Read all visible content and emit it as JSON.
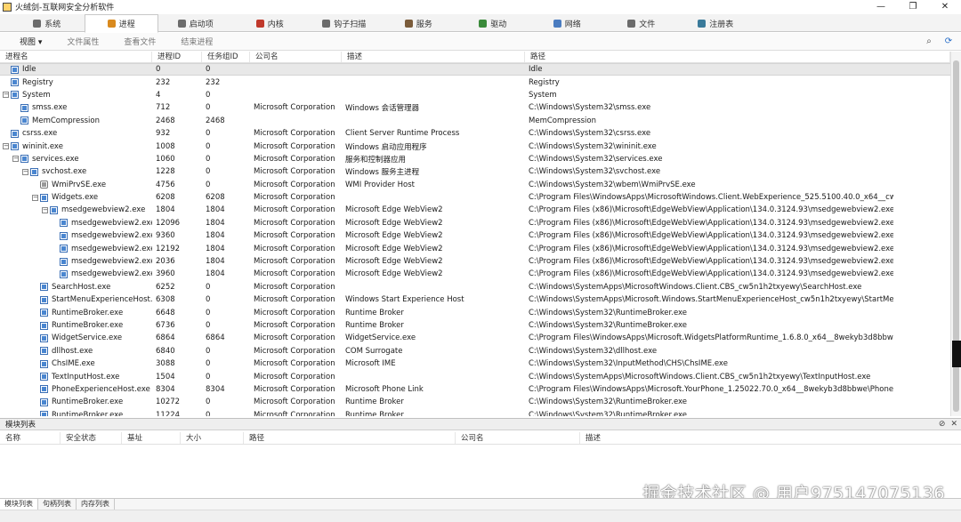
{
  "window": {
    "title": "火绒剑-互联网安全分析软件",
    "controls": [
      "—",
      "❐",
      "✕"
    ]
  },
  "tabs": [
    {
      "label": "系统",
      "icon": "system-icon",
      "color": "#6b6b6b"
    },
    {
      "label": "进程",
      "icon": "process-icon",
      "color": "#d98a1e",
      "active": true
    },
    {
      "label": "启动项",
      "icon": "startup-icon",
      "color": "#6b6b6b"
    },
    {
      "label": "内核",
      "icon": "kernel-icon",
      "color": "#c0392b"
    },
    {
      "label": "钩子扫描",
      "icon": "hook-icon",
      "color": "#6b6b6b"
    },
    {
      "label": "服务",
      "icon": "service-icon",
      "color": "#7a5b3a"
    },
    {
      "label": "驱动",
      "icon": "driver-icon",
      "color": "#3a8a3a"
    },
    {
      "label": "网络",
      "icon": "network-icon",
      "color": "#4a7cc0"
    },
    {
      "label": "文件",
      "icon": "file-icon",
      "color": "#6b6b6b"
    },
    {
      "label": "注册表",
      "icon": "registry-icon",
      "color": "#3a7a9a"
    }
  ],
  "toolbar": {
    "view": "视图 ▾",
    "file_props": "文件属性",
    "view_file": "查看文件",
    "end_process": "结束进程"
  },
  "columns": {
    "name": "进程名",
    "pid": "进程ID",
    "tgid": "任务组ID",
    "company": "公司名",
    "desc": "描述",
    "path": "路径"
  },
  "processes": [
    {
      "name": "Idle",
      "pid": "0",
      "tgid": "0",
      "company": "",
      "desc": "",
      "path": "Idle",
      "level": 0,
      "exp": "",
      "sel": true
    },
    {
      "name": "Registry",
      "pid": "232",
      "tgid": "232",
      "company": "",
      "desc": "",
      "path": "Registry",
      "level": 0,
      "exp": ""
    },
    {
      "name": "System",
      "pid": "4",
      "tgid": "0",
      "company": "",
      "desc": "",
      "path": "System",
      "level": 0,
      "exp": "−"
    },
    {
      "name": "smss.exe",
      "pid": "712",
      "tgid": "0",
      "company": "Microsoft Corporation",
      "desc": "Windows 会话管理器",
      "path": "C:\\Windows\\System32\\smss.exe",
      "level": 1,
      "exp": ""
    },
    {
      "name": "MemCompression",
      "pid": "2468",
      "tgid": "2468",
      "company": "",
      "desc": "",
      "path": "MemCompression",
      "level": 1,
      "exp": ""
    },
    {
      "name": "csrss.exe",
      "pid": "932",
      "tgid": "0",
      "company": "Microsoft Corporation",
      "desc": "Client Server Runtime Process",
      "path": "C:\\Windows\\System32\\csrss.exe",
      "level": 0,
      "exp": ""
    },
    {
      "name": "wininit.exe",
      "pid": "1008",
      "tgid": "0",
      "company": "Microsoft Corporation",
      "desc": "Windows 启动应用程序",
      "path": "C:\\Windows\\System32\\wininit.exe",
      "level": 0,
      "exp": "−"
    },
    {
      "name": "services.exe",
      "pid": "1060",
      "tgid": "0",
      "company": "Microsoft Corporation",
      "desc": "服务和控制器应用",
      "path": "C:\\Windows\\System32\\services.exe",
      "level": 1,
      "exp": "−"
    },
    {
      "name": "svchost.exe",
      "pid": "1228",
      "tgid": "0",
      "company": "Microsoft Corporation",
      "desc": "Windows 服务主进程",
      "path": "C:\\Windows\\System32\\svchost.exe",
      "level": 2,
      "exp": "−"
    },
    {
      "name": "WmiPrvSE.exe",
      "pid": "4756",
      "tgid": "0",
      "company": "Microsoft Corporation",
      "desc": "WMI Provider Host",
      "path": "C:\\Windows\\System32\\wbem\\WmiPrvSE.exe",
      "level": 3,
      "exp": "",
      "gear": true
    },
    {
      "name": "Widgets.exe",
      "pid": "6208",
      "tgid": "6208",
      "company": "Microsoft Corporation",
      "desc": "",
      "path": "C:\\Program Files\\WindowsApps\\MicrosoftWindows.Client.WebExperience_525.5100.40.0_x64__cw5n1...",
      "level": 3,
      "exp": "−"
    },
    {
      "name": "msedgewebview2.exe",
      "pid": "1804",
      "tgid": "1804",
      "company": "Microsoft Corporation",
      "desc": "Microsoft Edge WebView2",
      "path": "C:\\Program Files (x86)\\Microsoft\\EdgeWebView\\Application\\134.0.3124.93\\msedgewebview2.exe",
      "level": 4,
      "exp": "−"
    },
    {
      "name": "msedgewebview2.exe",
      "pid": "12096",
      "tgid": "1804",
      "company": "Microsoft Corporation",
      "desc": "Microsoft Edge WebView2",
      "path": "C:\\Program Files (x86)\\Microsoft\\EdgeWebView\\Application\\134.0.3124.93\\msedgewebview2.exe",
      "level": 5,
      "exp": ""
    },
    {
      "name": "msedgewebview2.exe",
      "pid": "9360",
      "tgid": "1804",
      "company": "Microsoft Corporation",
      "desc": "Microsoft Edge WebView2",
      "path": "C:\\Program Files (x86)\\Microsoft\\EdgeWebView\\Application\\134.0.3124.93\\msedgewebview2.exe",
      "level": 5,
      "exp": ""
    },
    {
      "name": "msedgewebview2.exe",
      "pid": "12192",
      "tgid": "1804",
      "company": "Microsoft Corporation",
      "desc": "Microsoft Edge WebView2",
      "path": "C:\\Program Files (x86)\\Microsoft\\EdgeWebView\\Application\\134.0.3124.93\\msedgewebview2.exe",
      "level": 5,
      "exp": ""
    },
    {
      "name": "msedgewebview2.exe",
      "pid": "2036",
      "tgid": "1804",
      "company": "Microsoft Corporation",
      "desc": "Microsoft Edge WebView2",
      "path": "C:\\Program Files (x86)\\Microsoft\\EdgeWebView\\Application\\134.0.3124.93\\msedgewebview2.exe",
      "level": 5,
      "exp": ""
    },
    {
      "name": "msedgewebview2.exe",
      "pid": "3960",
      "tgid": "1804",
      "company": "Microsoft Corporation",
      "desc": "Microsoft Edge WebView2",
      "path": "C:\\Program Files (x86)\\Microsoft\\EdgeWebView\\Application\\134.0.3124.93\\msedgewebview2.exe",
      "level": 5,
      "exp": ""
    },
    {
      "name": "SearchHost.exe",
      "pid": "6252",
      "tgid": "0",
      "company": "Microsoft Corporation",
      "desc": "",
      "path": "C:\\Windows\\SystemApps\\MicrosoftWindows.Client.CBS_cw5n1h2txyewy\\SearchHost.exe",
      "level": 3,
      "exp": ""
    },
    {
      "name": "StartMenuExperienceHost....",
      "pid": "6308",
      "tgid": "0",
      "company": "Microsoft Corporation",
      "desc": "Windows Start Experience Host",
      "path": "C:\\Windows\\SystemApps\\Microsoft.Windows.StartMenuExperienceHost_cw5n1h2txyewy\\StartMenuEx...",
      "level": 3,
      "exp": ""
    },
    {
      "name": "RuntimeBroker.exe",
      "pid": "6648",
      "tgid": "0",
      "company": "Microsoft Corporation",
      "desc": "Runtime Broker",
      "path": "C:\\Windows\\System32\\RuntimeBroker.exe",
      "level": 3,
      "exp": ""
    },
    {
      "name": "RuntimeBroker.exe",
      "pid": "6736",
      "tgid": "0",
      "company": "Microsoft Corporation",
      "desc": "Runtime Broker",
      "path": "C:\\Windows\\System32\\RuntimeBroker.exe",
      "level": 3,
      "exp": ""
    },
    {
      "name": "WidgetService.exe",
      "pid": "6864",
      "tgid": "6864",
      "company": "Microsoft Corporation",
      "desc": "WidgetService.exe",
      "path": "C:\\Program Files\\WindowsApps\\Microsoft.WidgetsPlatformRuntime_1.6.8.0_x64__8wekyb3d8bbwe\\W...",
      "level": 3,
      "exp": ""
    },
    {
      "name": "dllhost.exe",
      "pid": "6840",
      "tgid": "0",
      "company": "Microsoft Corporation",
      "desc": "COM Surrogate",
      "path": "C:\\Windows\\System32\\dllhost.exe",
      "level": 3,
      "exp": ""
    },
    {
      "name": "ChsIME.exe",
      "pid": "3088",
      "tgid": "0",
      "company": "Microsoft Corporation",
      "desc": "Microsoft IME",
      "path": "C:\\Windows\\System32\\InputMethod\\CHS\\ChsIME.exe",
      "level": 3,
      "exp": ""
    },
    {
      "name": "TextInputHost.exe",
      "pid": "1504",
      "tgid": "0",
      "company": "Microsoft Corporation",
      "desc": "",
      "path": "C:\\Windows\\SystemApps\\MicrosoftWindows.Client.CBS_cw5n1h2txyewy\\TextInputHost.exe",
      "level": 3,
      "exp": ""
    },
    {
      "name": "PhoneExperienceHost.exe",
      "pid": "8304",
      "tgid": "8304",
      "company": "Microsoft Corporation",
      "desc": "Microsoft Phone Link",
      "path": "C:\\Program Files\\WindowsApps\\Microsoft.YourPhone_1.25022.70.0_x64__8wekyb3d8bbwe\\PhoneExp...",
      "level": 3,
      "exp": ""
    },
    {
      "name": "RuntimeBroker.exe",
      "pid": "10272",
      "tgid": "0",
      "company": "Microsoft Corporation",
      "desc": "Runtime Broker",
      "path": "C:\\Windows\\System32\\RuntimeBroker.exe",
      "level": 3,
      "exp": ""
    },
    {
      "name": "RuntimeBroker.exe",
      "pid": "11224",
      "tgid": "0",
      "company": "Microsoft Corporation",
      "desc": "Runtime Broker",
      "path": "C:\\Windows\\System32\\RuntimeBroker.exe",
      "level": 3,
      "exp": ""
    }
  ],
  "module_pane": {
    "title": "模块列表",
    "buttons": [
      "⊘",
      "✕"
    ],
    "columns": [
      "名称",
      "安全状态",
      "基址",
      "大小",
      "路径",
      "公司名",
      "描述"
    ]
  },
  "bottom_tabs": [
    "模块列表",
    "句柄列表",
    "内存列表"
  ],
  "watermark": "掘金技术社区 @ 用户975147075136",
  "toolbar_icons": {
    "binoculars": "⌕",
    "refresh": "⟳"
  }
}
